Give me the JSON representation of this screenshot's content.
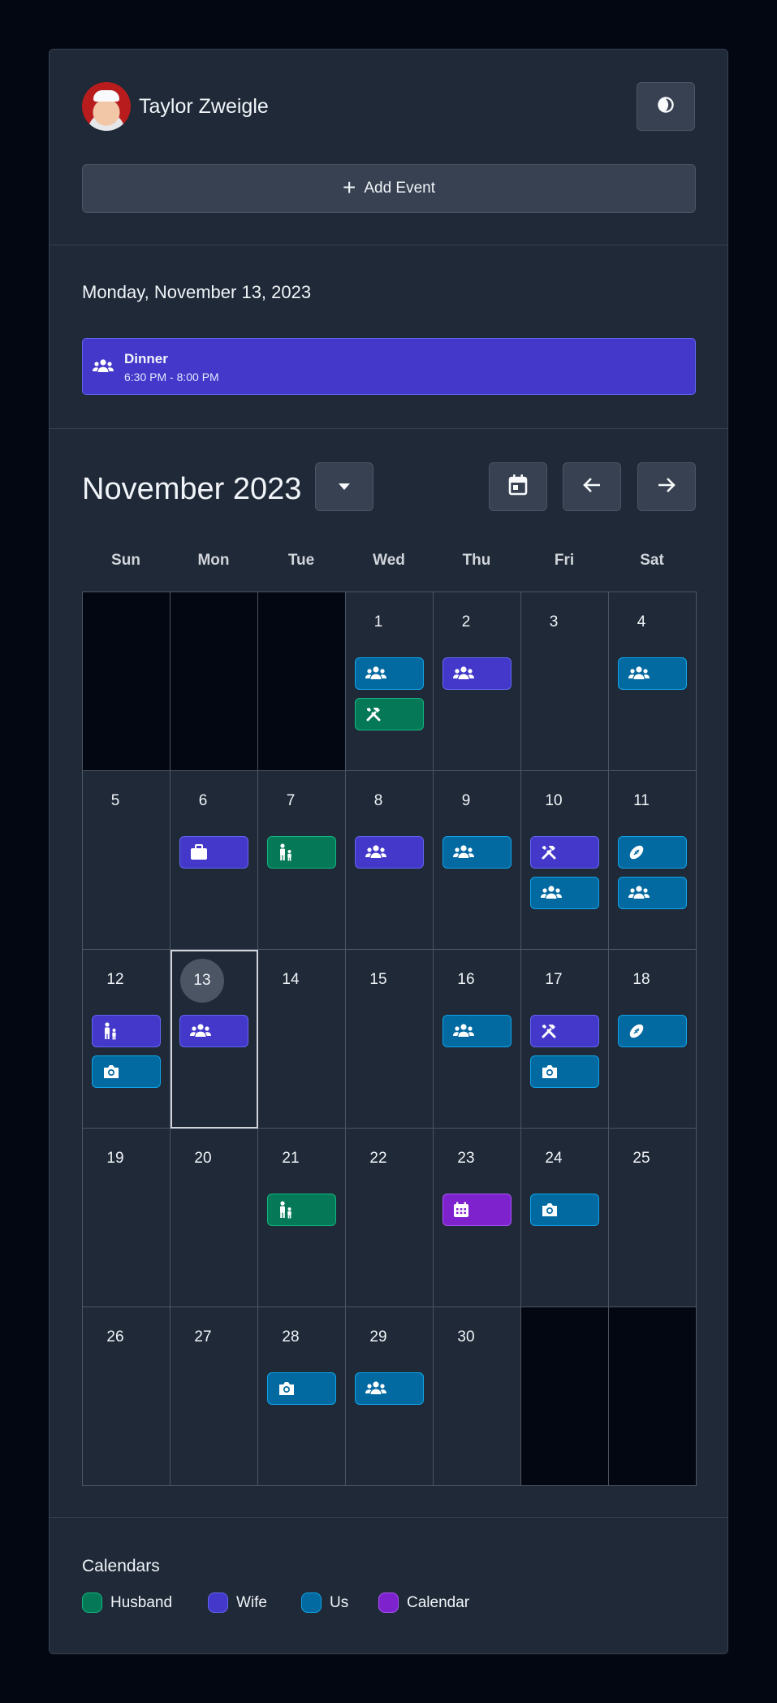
{
  "user": {
    "name": "Taylor Zweigle"
  },
  "header": {
    "theme_icon": "moon-icon",
    "add_event_label": "Add Event"
  },
  "selected_day": {
    "title": "Monday, November 13, 2023",
    "event": {
      "title": "Dinner",
      "time": "6:30 PM - 8:00 PM",
      "icon": "people-icon",
      "calendar": "Wife"
    }
  },
  "calendar": {
    "month_title": "November 2023",
    "weekdays": [
      "Sun",
      "Mon",
      "Tue",
      "Wed",
      "Thu",
      "Fri",
      "Sat"
    ],
    "today": 13,
    "leading_empty": 3,
    "trailing_empty": 2,
    "days": [
      {
        "n": "1",
        "events": [
          {
            "cal": "us",
            "icon": "people"
          },
          {
            "cal": "husband",
            "icon": "tools"
          }
        ]
      },
      {
        "n": "2",
        "events": [
          {
            "cal": "wife",
            "icon": "people"
          }
        ]
      },
      {
        "n": "3",
        "events": []
      },
      {
        "n": "4",
        "events": [
          {
            "cal": "us",
            "icon": "people"
          }
        ]
      },
      {
        "n": "5",
        "events": []
      },
      {
        "n": "6",
        "events": [
          {
            "cal": "wife",
            "icon": "briefcase"
          }
        ]
      },
      {
        "n": "7",
        "events": [
          {
            "cal": "husband",
            "icon": "parent-child"
          }
        ]
      },
      {
        "n": "8",
        "events": [
          {
            "cal": "wife",
            "icon": "people"
          }
        ]
      },
      {
        "n": "9",
        "events": [
          {
            "cal": "us",
            "icon": "people"
          }
        ]
      },
      {
        "n": "10",
        "events": [
          {
            "cal": "wife",
            "icon": "tools"
          },
          {
            "cal": "us",
            "icon": "people"
          }
        ]
      },
      {
        "n": "11",
        "events": [
          {
            "cal": "us",
            "icon": "football"
          },
          {
            "cal": "us",
            "icon": "people"
          }
        ]
      },
      {
        "n": "12",
        "events": [
          {
            "cal": "wife",
            "icon": "parent-child"
          },
          {
            "cal": "us",
            "icon": "camera"
          }
        ]
      },
      {
        "n": "13",
        "events": [
          {
            "cal": "wife",
            "icon": "people"
          }
        ]
      },
      {
        "n": "14",
        "events": []
      },
      {
        "n": "15",
        "events": []
      },
      {
        "n": "16",
        "events": [
          {
            "cal": "us",
            "icon": "people"
          }
        ]
      },
      {
        "n": "17",
        "events": [
          {
            "cal": "wife",
            "icon": "tools"
          },
          {
            "cal": "us",
            "icon": "camera"
          }
        ]
      },
      {
        "n": "18",
        "events": [
          {
            "cal": "us",
            "icon": "football"
          }
        ]
      },
      {
        "n": "19",
        "events": []
      },
      {
        "n": "20",
        "events": []
      },
      {
        "n": "21",
        "events": [
          {
            "cal": "husband",
            "icon": "parent-child"
          }
        ]
      },
      {
        "n": "22",
        "events": []
      },
      {
        "n": "23",
        "events": [
          {
            "cal": "cal",
            "icon": "calendar"
          }
        ]
      },
      {
        "n": "24",
        "events": [
          {
            "cal": "us",
            "icon": "camera"
          }
        ]
      },
      {
        "n": "25",
        "events": []
      },
      {
        "n": "26",
        "events": []
      },
      {
        "n": "27",
        "events": []
      },
      {
        "n": "28",
        "events": [
          {
            "cal": "us",
            "icon": "camera"
          }
        ]
      },
      {
        "n": "29",
        "events": [
          {
            "cal": "us",
            "icon": "people"
          }
        ]
      },
      {
        "n": "30",
        "events": []
      }
    ]
  },
  "legend": {
    "title": "Calendars",
    "items": [
      {
        "label": "Husband",
        "key": "husband",
        "color": "#047857"
      },
      {
        "label": "Wife",
        "key": "wife",
        "color": "#4338ca"
      },
      {
        "label": "Us",
        "key": "us",
        "color": "#0369a1"
      },
      {
        "label": "Calendar",
        "key": "cal",
        "color": "#7e22ce"
      }
    ]
  },
  "colors": {
    "background": "#030712",
    "card": "#1f2937",
    "husband": "#047857",
    "wife": "#4338ca",
    "us": "#0369a1",
    "calendar": "#7e22ce"
  }
}
